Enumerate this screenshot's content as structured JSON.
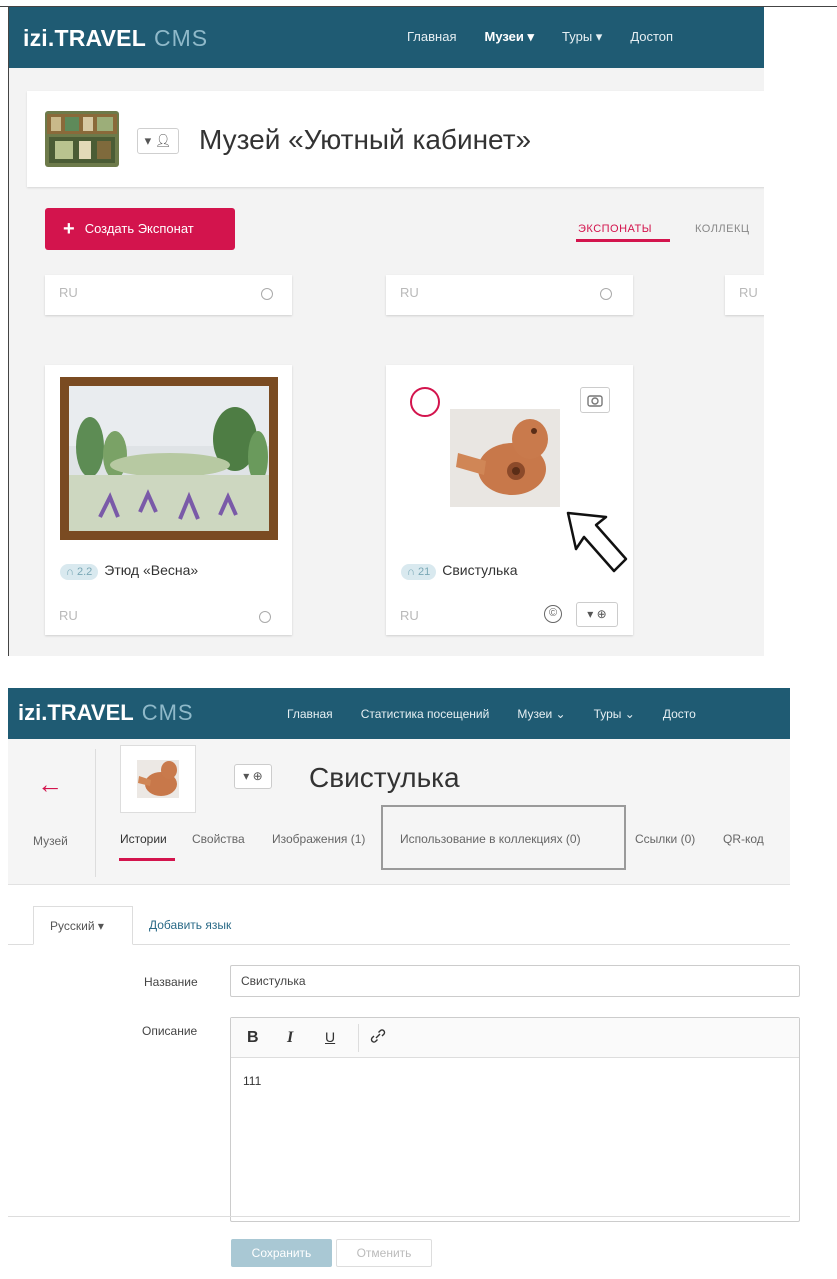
{
  "museum_list": {
    "brand": "izi.TRAVEL",
    "brand_suffix": "CMS",
    "nav": [
      "Главная",
      "Музеи ▾",
      "Туры ▾",
      "Достоп"
    ],
    "museum_title": "Музей «Уютный кабинет»",
    "create_button": "Создать Экспонат",
    "tab_exhibits": "ЭКСПОНАТЫ",
    "tab_collections": "КОЛЛЕКЦ",
    "top_row_lang": [
      "RU",
      "RU",
      "RU"
    ],
    "cards": [
      {
        "badge": "2.2",
        "title": "Этюд «Весна»",
        "lang": "RU"
      },
      {
        "badge": "21",
        "title": "Свистулька",
        "lang": "RU"
      }
    ]
  },
  "exhibit_editor": {
    "brand": "izi.TRAVEL",
    "brand_suffix": "CMS",
    "nav": [
      "Главная",
      "Статистика посещений",
      "Музеи ⌄",
      "Туры ⌄",
      "Досто"
    ],
    "title": "Свистулька",
    "crumb": "Музей",
    "tabs": [
      "Истории",
      "Свойства",
      "Изображения (1)",
      "Использование в коллекциях (0)",
      "Ссылки (0)",
      "QR-код"
    ],
    "language_select": "Русский ▾",
    "add_language": "Добавить язык",
    "name_label": "Название",
    "name_value": "Свистулька",
    "description_label": "Описание",
    "toolbar": {
      "bold": "B",
      "italic": "I",
      "underline": "U"
    },
    "description_value": "111",
    "save_button": "Сохранить",
    "cancel_button": "Отменить"
  },
  "colors": {
    "navbar": "#1f5b73",
    "accent": "#d3144d",
    "link": "#2a6a87"
  }
}
